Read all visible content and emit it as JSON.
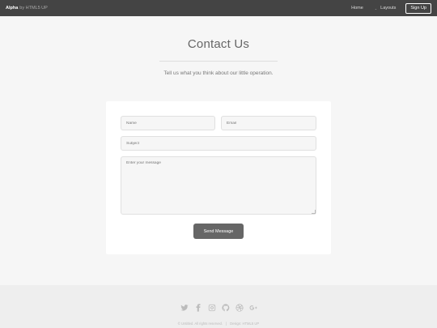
{
  "header": {
    "brand": "Alpha",
    "by_text": "by HTML5 UP",
    "nav": {
      "home": "Home",
      "layouts": "Layouts",
      "signup": "Sign Up"
    }
  },
  "main": {
    "title": "Contact Us",
    "subtitle": "Tell us what you think about our little operation."
  },
  "form": {
    "name_placeholder": "Name",
    "email_placeholder": "Email",
    "subject_placeholder": "Subject",
    "message_placeholder": "Enter your message",
    "send_label": "Send Message"
  },
  "footer": {
    "social_icons": [
      "twitter-icon",
      "facebook-icon",
      "instagram-icon",
      "github-icon",
      "dribbble-icon",
      "google-plus-icon"
    ],
    "copyright": "© Untitled. All rights reserved.",
    "design": "Design: HTML5 UP"
  }
}
